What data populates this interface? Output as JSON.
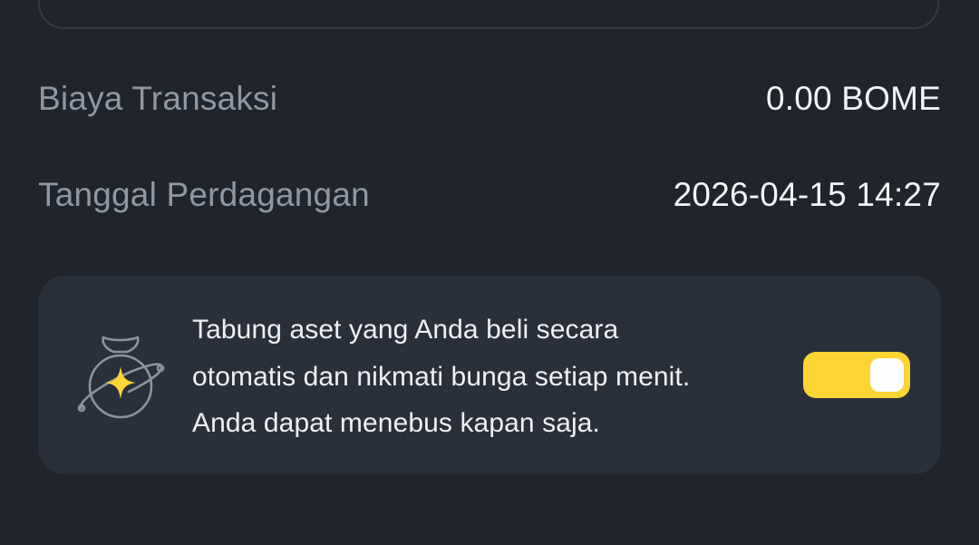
{
  "details": {
    "fee_label": "Biaya Transaksi",
    "fee_value": "0.00 BOME",
    "date_label": "Tanggal Perdagangan",
    "date_value": "2026-04-15 14:27"
  },
  "promo": {
    "icon": "money-bag-sparkle-icon",
    "lines": [
      "Tabung aset yang Anda beli secara",
      "otomatis dan nikmati bunga setiap menit.",
      "Anda dapat menebus kapan saja."
    ],
    "toggle_on": true
  },
  "colors": {
    "background": "#1f242d",
    "card": "#2a303b",
    "label": "#8f97a4",
    "value": "#f3f4f6",
    "accent": "#fcd535"
  }
}
